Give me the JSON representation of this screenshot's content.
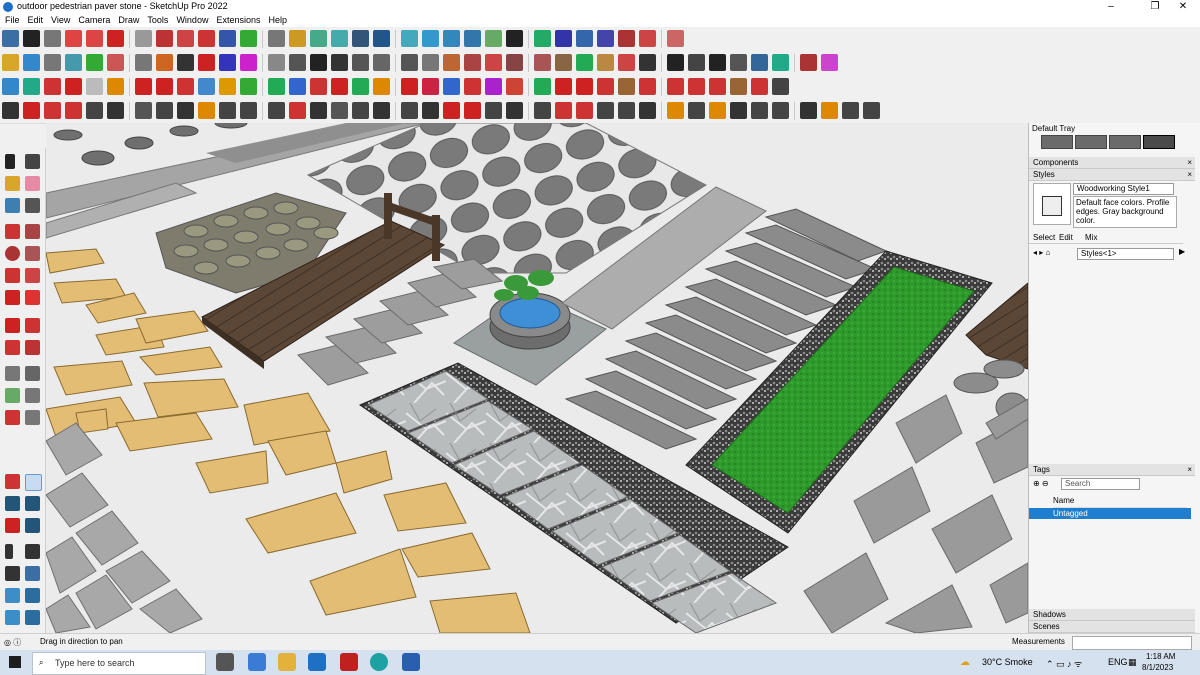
{
  "window": {
    "title": "outdoor pedestrian paver stone - SketchUp Pro 2022",
    "minimize": "–",
    "maximize": "❐",
    "close": "✕"
  },
  "menu": [
    "File",
    "Edit",
    "View",
    "Camera",
    "Draw",
    "Tools",
    "Window",
    "Extensions",
    "Help"
  ],
  "toolbar_colors": {
    "row1": [
      "#3b6ea5",
      "#222",
      "#777",
      "#d44",
      "#d44",
      "#c22",
      "#999",
      "#b33",
      "#c44",
      "#c33",
      "#35a",
      "#3a3",
      "#777",
      "#c92",
      "#4a8",
      "#4aa",
      "#357",
      "#258",
      "#4ab",
      "#39c",
      "#38b",
      "#37a",
      "#6a6",
      "#222",
      "#2a6",
      "#33a",
      "#36a",
      "#44a",
      "#a33",
      "#c44",
      "#c66"
    ],
    "row2": [
      "#d8a72a",
      "#38c",
      "#777",
      "#49a",
      "#3a3",
      "#c55",
      "#777",
      "#c62",
      "#333",
      "#c22",
      "#33b",
      "#c2c",
      "#888",
      "#555",
      "#222",
      "#333",
      "#555",
      "#666",
      "#555",
      "#777",
      "#b63",
      "#a44",
      "#c44",
      "#844",
      "#a55",
      "#864",
      "#2a5",
      "#b84",
      "#c44",
      "#333",
      "#222",
      "#444",
      "#222",
      "#555",
      "#369",
      "#2a8",
      "#a33",
      "#c4c"
    ],
    "row3": [
      "#38c",
      "#2a8",
      "#c33",
      "#c22",
      "#bbb",
      "#d80",
      "#c22",
      "#c22",
      "#c33",
      "#48c",
      "#d90",
      "#3a3",
      "#2a5",
      "#36c",
      "#c33",
      "#c22",
      "#2a5",
      "#d80",
      "#c22",
      "#c24",
      "#36c",
      "#c33",
      "#a2c",
      "#c43",
      "#2a5",
      "#c22",
      "#c22",
      "#c33",
      "#963",
      "#c33",
      "#c33",
      "#c33",
      "#c33",
      "#963",
      "#c33",
      "#444"
    ],
    "row4": [
      "#333",
      "#c22",
      "#c33",
      "#c33",
      "#444",
      "#333",
      "#555",
      "#444",
      "#333",
      "#d80",
      "#444",
      "#444",
      "#444",
      "#c33",
      "#333",
      "#555",
      "#444",
      "#333",
      "#444",
      "#333",
      "#c22",
      "#c22",
      "#444",
      "#333",
      "#444",
      "#c33",
      "#c33",
      "#444",
      "#444",
      "#333",
      "#d80",
      "#444",
      "#d80",
      "#333",
      "#444",
      "#444",
      "#333",
      "#d80",
      "#444",
      "#444"
    ]
  },
  "tray": {
    "title": "Default Tray",
    "components": "Components",
    "styles": "Styles",
    "style_name": "Woodworking Style1",
    "style_desc": "Default face colors. Profile edges. Gray background color.",
    "tabs": [
      "Select",
      "Edit",
      "Mix"
    ],
    "collection": "Styles<1>",
    "tags": "Tags",
    "search_placeholder": "Search",
    "name_col": "Name",
    "tag_row": "Untagged",
    "shadows": "Shadows",
    "scenes": "Scenes"
  },
  "status": {
    "hint": "Drag in direction to pan",
    "measurements": "Measurements"
  },
  "taskbar": {
    "search_placeholder": "Type here to search",
    "weather": "30°C  Smoke",
    "lang": "ENG",
    "time": "1:18 AM",
    "date": "8/1/2023"
  },
  "colors": {
    "accent": "#1e7fd0",
    "grass": "#2f9a2c",
    "sandstone": "#e3bd73",
    "stone": "#8d8d8d",
    "wood": "#5a4533"
  }
}
